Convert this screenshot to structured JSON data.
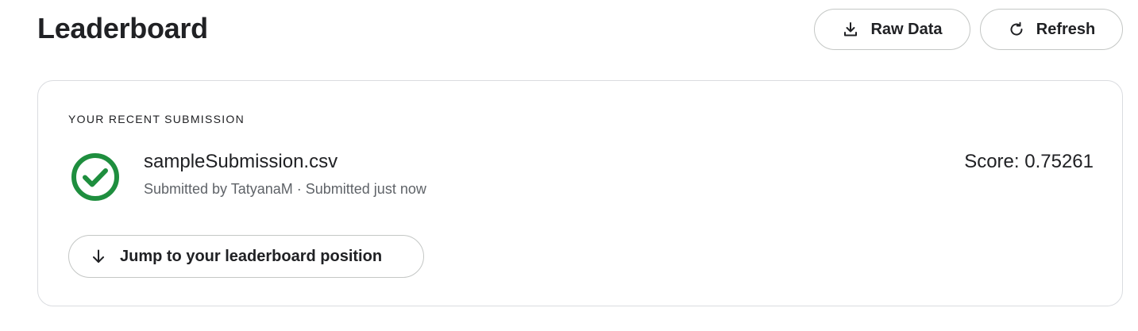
{
  "header": {
    "title": "Leaderboard",
    "raw_data_label": "Raw Data",
    "refresh_label": "Refresh",
    "raw_data_icon": "download-icon",
    "refresh_icon": "refresh-icon"
  },
  "recent_submission": {
    "section_label": "YOUR RECENT SUBMISSION",
    "status_icon": "check-circle-icon",
    "status_color": "#1e8e3e",
    "file_name": "sampleSubmission.csv",
    "meta": "Submitted by TatyanaM · Submitted just now",
    "score": "Score: 0.75261",
    "jump_label": "Jump to your leaderboard position",
    "jump_icon": "arrow-down-icon"
  }
}
